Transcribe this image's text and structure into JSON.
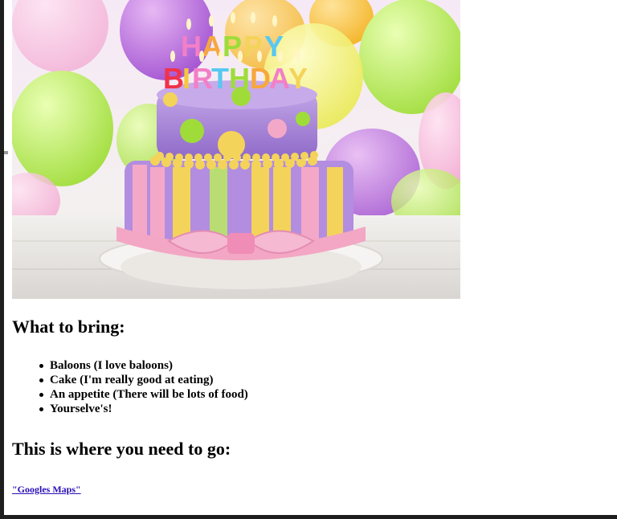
{
  "headings": {
    "bring": "What to bring:",
    "go": "This is where you need to go:"
  },
  "bring_list": [
    "Baloons (I love baloons)",
    "Cake (I'm really good at eating)",
    "An appetite (There will be lots of food)",
    "Yourselve's!"
  ],
  "image": {
    "cake_text": "HAPPY BIRTHDAY",
    "colors": {
      "cake_lavender": "#a98ad6",
      "stripe_pink": "#f4a8c8",
      "stripe_yellow": "#f4d35a",
      "stripe_green": "#b9dd72",
      "ribbon_pink": "#f3a7c4"
    }
  },
  "link": {
    "label": "\"Googles Maps\""
  }
}
